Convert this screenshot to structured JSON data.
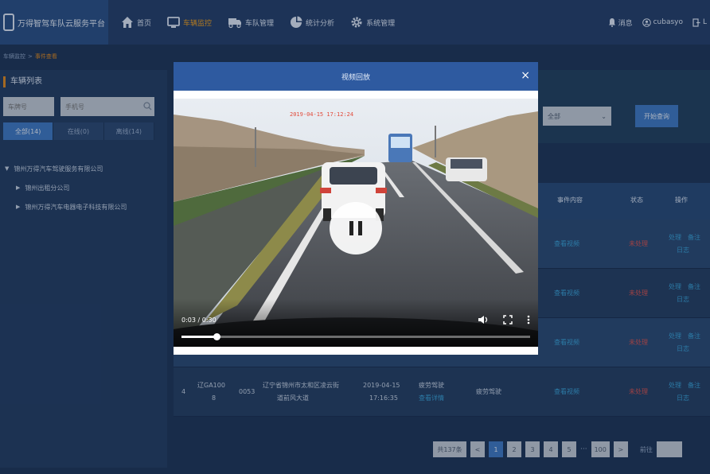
{
  "app": {
    "title": "万得智驾车队云服务平台"
  },
  "nav": [
    {
      "label": "首页",
      "active": false
    },
    {
      "label": "车辆监控",
      "active": true
    },
    {
      "label": "车队管理",
      "active": false
    },
    {
      "label": "统计分析",
      "active": false
    },
    {
      "label": "系统管理",
      "active": false
    }
  ],
  "right_tools": {
    "messages": "消息",
    "user": "cubasyo",
    "logout": "L"
  },
  "breadcrumb": {
    "root": "车辆监控",
    "sep": ">",
    "current": "事件查看"
  },
  "left_panel": {
    "title": "车辆列表",
    "plate_placeholder": "车牌号",
    "phone_placeholder": "手机号",
    "tabs": [
      {
        "label": "全部(14)",
        "active": true
      },
      {
        "label": "在线(0)",
        "active": false
      },
      {
        "label": "离线(14)",
        "active": false
      }
    ],
    "tree": [
      {
        "label": "锦州万得汽车驾驶服务有限公司",
        "level": 0
      },
      {
        "label": "锦州出租分公司",
        "level": 1
      },
      {
        "label": "锦州万得汽车电器电子科技有限公司",
        "level": 1
      }
    ]
  },
  "filters": {
    "status_value": "全部",
    "query_label": "开始查询"
  },
  "table": {
    "headers": {
      "content": "事件内容",
      "status": "状态",
      "actions": "操作"
    },
    "rows": [
      {
        "index": "",
        "plate": "",
        "code": "",
        "location": "",
        "time": "",
        "event_type": "",
        "event_link": "",
        "desc": "",
        "content": "查看视频",
        "status": "未处理",
        "act1": "处理",
        "act2": "备注",
        "act3": "日志"
      },
      {
        "index": "",
        "plate": "",
        "code": "",
        "location": "",
        "time": "",
        "event_type": "",
        "event_link": "",
        "desc": "",
        "content": "查看视频",
        "status": "未处理",
        "act1": "处理",
        "act2": "备注",
        "act3": "日志"
      },
      {
        "index": "",
        "plate": "",
        "code": "",
        "location": "",
        "time": "",
        "event_type": "",
        "event_link": "",
        "desc": "",
        "content": "查看视频",
        "status": "未处理",
        "act1": "处理",
        "act2": "备注",
        "act3": "日志"
      },
      {
        "index": "4",
        "plate_l1": "辽GA100",
        "plate_l2": "8",
        "code": "0053",
        "location_l1": "辽宁省锦州市太和区凌云街",
        "location_l2": "道前风大道",
        "time_l1": "2019-04-15",
        "time_l2": "17:16:35",
        "event_type": "疲劳驾驶",
        "event_link": "查看详情",
        "desc": "疲劳驾驶",
        "content": "查看视频",
        "status": "未处理",
        "act1": "处理",
        "act2": "备注",
        "act3": "日志"
      }
    ]
  },
  "pagination": {
    "total": "共137条",
    "prev": "<",
    "pages": [
      "1",
      "2",
      "3",
      "4",
      "5"
    ],
    "active_page": "1",
    "dots": "···",
    "last": "100",
    "next": ">",
    "goto_label": "前往"
  },
  "modal": {
    "title": "视频回放",
    "close": "×",
    "video": {
      "overlay_timestamp": "2019-04-15 17:12:24",
      "time_display": "0:03 / 0:30",
      "progress": 0.1
    }
  }
}
